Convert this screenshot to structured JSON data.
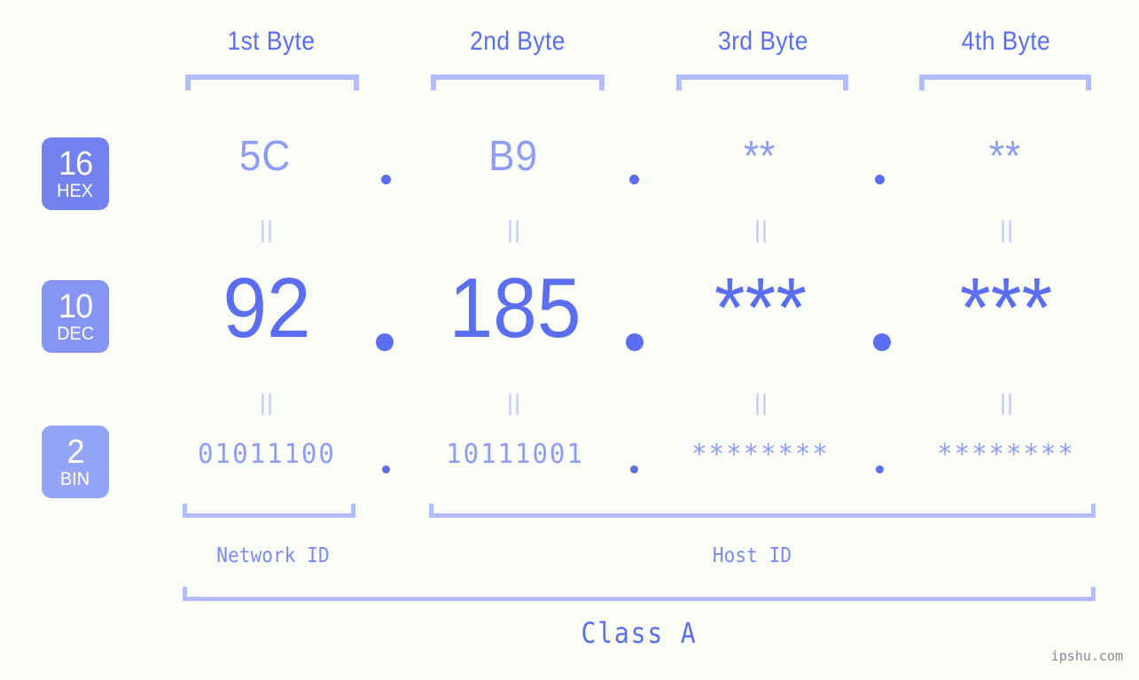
{
  "page": {
    "background_color": "#fbfdf8",
    "accent_color": "#5c6ef0",
    "accent_light_color": "#8e9cf5",
    "bracket_color": "#b3bdfb",
    "watermark": "ipshu.com"
  },
  "byte_headers": [
    {
      "label": "1st Byte"
    },
    {
      "label": "2nd Byte"
    },
    {
      "label": "3rd Byte"
    },
    {
      "label": "4th Byte"
    }
  ],
  "bases": [
    {
      "number": "16",
      "name": "HEX",
      "color": "#7382ee"
    },
    {
      "number": "10",
      "name": "DEC",
      "color": "#8694f4"
    },
    {
      "number": "2",
      "name": "BIN",
      "color": "#94a5f7"
    }
  ],
  "rows": {
    "hex": {
      "base_number": "16",
      "base_name": "HEX",
      "values": [
        "5C",
        "B9",
        "**",
        "**"
      ],
      "separator": "."
    },
    "dec": {
      "base_number": "10",
      "base_name": "DEC",
      "values": [
        "92",
        "185",
        "***",
        "***"
      ],
      "separator": "."
    },
    "bin": {
      "base_number": "2",
      "base_name": "BIN",
      "values": [
        "01011100",
        "10111001",
        "********",
        "********"
      ],
      "separator": "."
    }
  },
  "equals_marks": {
    "glyph": "||",
    "count_per_row": 4
  },
  "sections": [
    {
      "label": "Network ID"
    },
    {
      "label": "Host ID"
    }
  ],
  "class": {
    "label": "Class A"
  }
}
